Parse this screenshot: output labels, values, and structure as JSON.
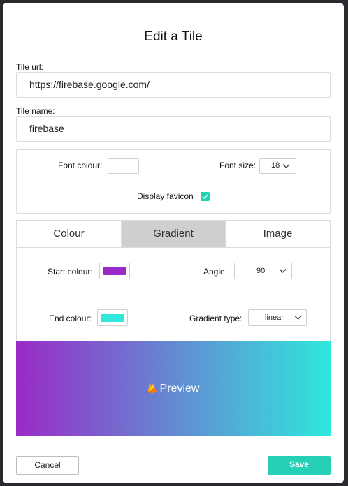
{
  "dialog": {
    "title": "Edit a Tile"
  },
  "tile_url": {
    "label": "Tile url:",
    "value": "https://firebase.google.com/"
  },
  "tile_name": {
    "label": "Tile name:",
    "value": "firebase"
  },
  "font": {
    "colour_label": "Font colour:",
    "colour_value": "#ffffff",
    "size_label": "Font size:",
    "size_value": "18"
  },
  "favicon": {
    "label": "Display favicon",
    "checked": true
  },
  "tabs": [
    {
      "label": "Colour",
      "active": false
    },
    {
      "label": "Gradient",
      "active": true
    },
    {
      "label": "Image",
      "active": false
    }
  ],
  "gradient": {
    "start_label": "Start colour:",
    "start_colour": "#9a2bc8",
    "end_label": "End colour:",
    "end_colour": "#2ee8dc",
    "angle_label": "Angle:",
    "angle_value": "90",
    "type_label": "Gradient type:",
    "type_value": "linear"
  },
  "preview": {
    "label": "Preview",
    "icon": "firebase-icon"
  },
  "buttons": {
    "cancel": "Cancel",
    "save": "Save"
  },
  "colors": {
    "accent": "#26d0b6"
  }
}
